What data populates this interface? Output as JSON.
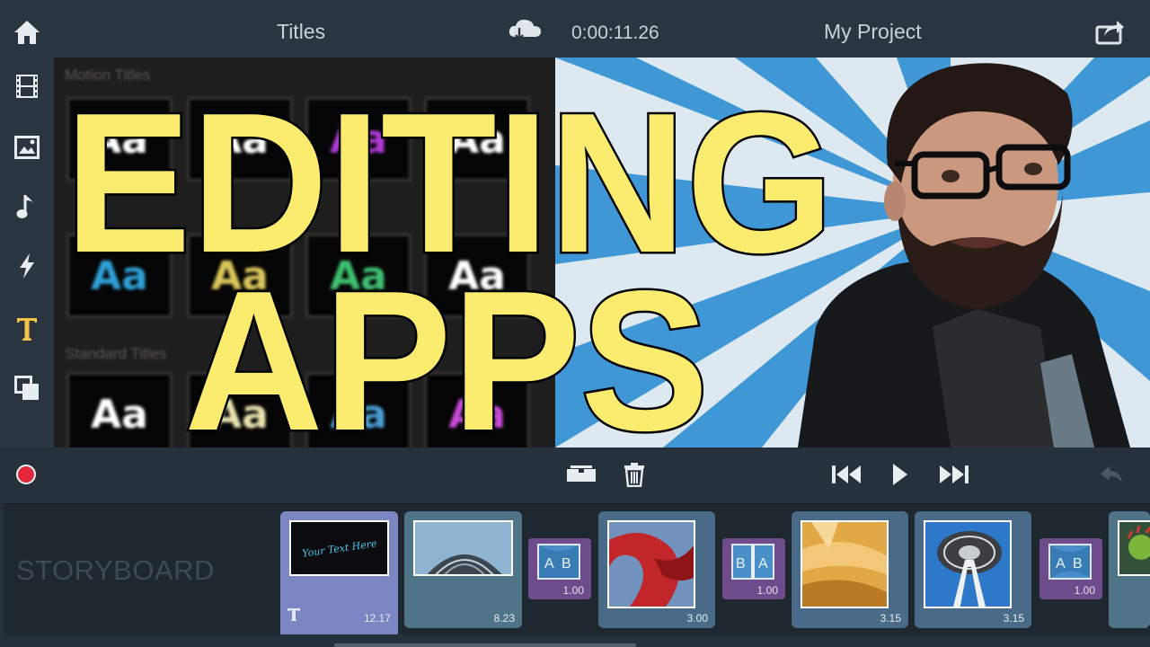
{
  "header": {
    "panel_title": "Titles",
    "timecode": "0:00:11.26",
    "project_name": "My Project"
  },
  "sidebar": {
    "items": [
      {
        "name": "home-icon",
        "active": false
      },
      {
        "name": "film-icon",
        "active": false
      },
      {
        "name": "photo-icon",
        "active": false
      },
      {
        "name": "music-note-icon",
        "active": false
      },
      {
        "name": "lightning-icon",
        "active": false
      },
      {
        "name": "text-t-icon",
        "active": true
      },
      {
        "name": "overlay-icon",
        "active": false
      }
    ],
    "active_color": "#f5c34a"
  },
  "titles_panel": {
    "sections": [
      "Motion Titles",
      "Standard Titles"
    ],
    "tile_label": "Aa",
    "tile_colors": [
      "#ffffff",
      "#ffffff",
      "#b03bd6",
      "#ffffff",
      "#2f9fd4",
      "#d9c65a",
      "#3fbf70",
      "#ffffff",
      "#ffffff",
      "#e8e3b0",
      "#4a9dd2",
      "#c64ad6"
    ]
  },
  "headline": {
    "line1": "EDITING",
    "line2": "APPS"
  },
  "storyboard": {
    "label": "STORYBOARD",
    "clips": [
      {
        "kind": "title",
        "duration": "12.17",
        "thumb_text": "Your Text Here",
        "selected": true
      },
      {
        "kind": "video",
        "duration": "8.23",
        "thumb": "tower-roof"
      },
      {
        "kind": "transition",
        "duration": "1.00",
        "icon": "A B"
      },
      {
        "kind": "video",
        "duration": "3.00",
        "thumb": "red-sculpture"
      },
      {
        "kind": "transition",
        "duration": "1.00",
        "icon": "B A"
      },
      {
        "kind": "video",
        "duration": "3.15",
        "thumb": "gold-building"
      },
      {
        "kind": "video",
        "duration": "3.15",
        "thumb": "space-needle"
      },
      {
        "kind": "transition",
        "duration": "1.00",
        "icon": "A B"
      }
    ]
  },
  "colors": {
    "headline_fill": "#fbeb6e",
    "clip_bg": "#4a6b88",
    "transition_bg": "#6e4b8a",
    "record": "#e0293a"
  }
}
